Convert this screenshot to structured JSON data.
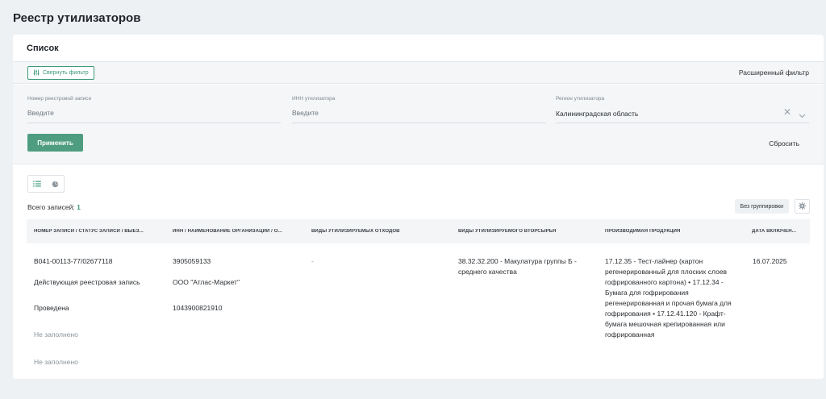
{
  "page": {
    "title": "Реестр утилизаторов"
  },
  "card": {
    "title": "Список"
  },
  "filter_bar": {
    "collapse_label": "Свернуть фильтр",
    "advanced_label": "Расширенный фильтр"
  },
  "filters": {
    "record_number": {
      "label": "Номер реестровой записи",
      "placeholder": "Введите"
    },
    "inn": {
      "label": "ИНН утилизатора",
      "placeholder": "Введите"
    },
    "region": {
      "label": "Регион утилизатора",
      "value": "Калининградская область"
    },
    "apply_label": "Применить",
    "reset_label": "Сбросить"
  },
  "list": {
    "total_label": "Всего записей:",
    "total_count": "1",
    "grouping_label": "Без группировки"
  },
  "table": {
    "columns": [
      "Номер записи / статус записи / выез...",
      "ИНН / наименование организации / О...",
      "Виды утилизируемых отходов",
      "Виды утилизируемого вторсырья",
      "Производимая продукция",
      "Дата включен..."
    ],
    "rows": [
      {
        "record_number": "В041-00113-77/02677118",
        "record_status": "Действующая реестровая запись",
        "inspection": "Проведена",
        "empty_1": "Не заполнено",
        "empty_2": "Не заполнено",
        "inn": "3905059133",
        "org_name": "ООО \"Атлас-Маркет\"",
        "ogrn": "1043900821910",
        "waste_types": "-",
        "recyclables": "38.32.32.200 - Макулатура группы Б - среднего качества",
        "products": "17.12.35 - Тест-лайнер (картон регенерированный для плоских слоев гофрированного картона) • 17.12.34 - Бумага для гофрирования регенерированная и прочая бумага для гофрирования • 17.12.41.120 - Крафт-бумага мешочная крепированная или гофрированная",
        "date_included": "16.07.2025"
      }
    ]
  },
  "colors": {
    "accent": "#3d9a77",
    "apply_bg": "#4f9d80",
    "page_bg": "#eef1f4"
  }
}
